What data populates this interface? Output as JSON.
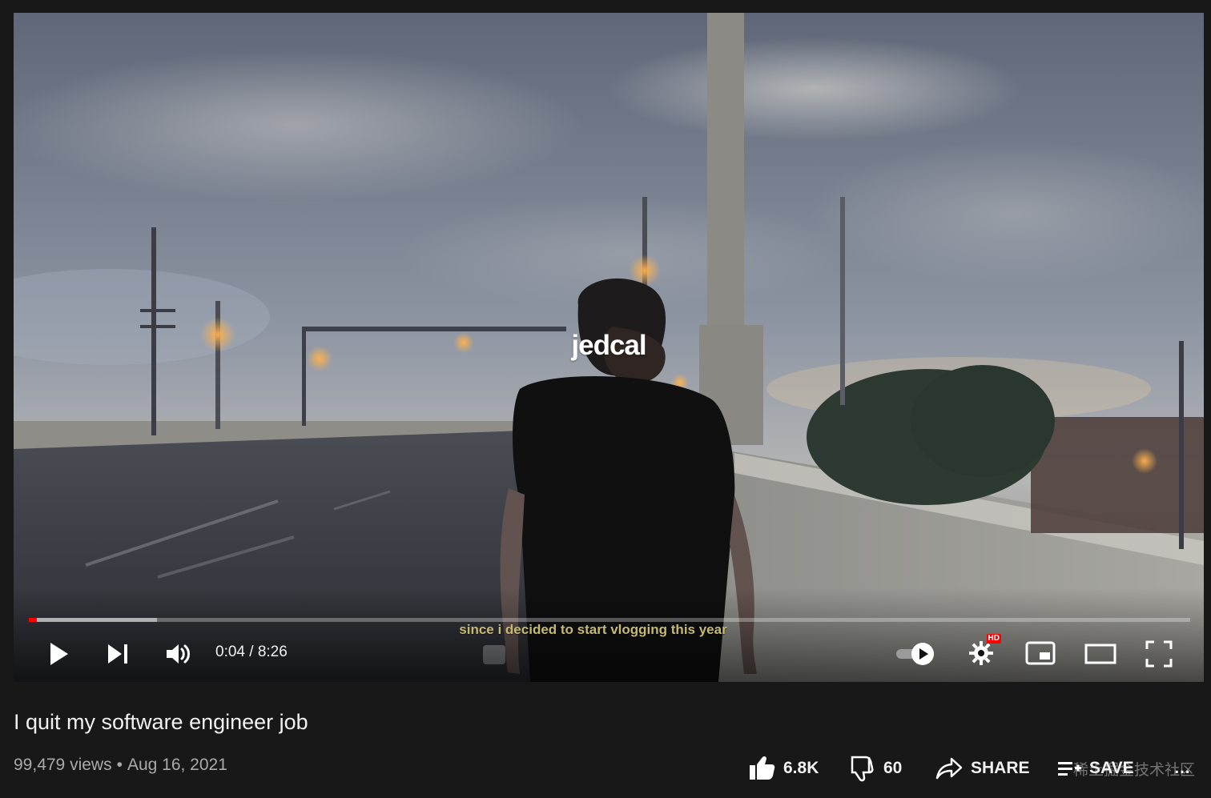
{
  "player": {
    "watermark": "jedcal",
    "caption": "since i decided to start vlogging this year",
    "time_current": "0:04",
    "time_separator": " / ",
    "time_total": "8:26",
    "progress_played_fraction": 0.007,
    "progress_buffered_fraction": 0.11,
    "hd_badge": "HD",
    "autoplay_toggle_state": "on",
    "icons": {
      "play": "play-icon",
      "next": "next-icon",
      "volume": "volume-icon",
      "autoplay": "autoplay-toggle-icon",
      "settings": "settings-gear-icon",
      "miniplayer": "miniplayer-icon",
      "theater": "theater-mode-icon",
      "fullscreen": "fullscreen-icon"
    }
  },
  "video": {
    "title": "I quit my software engineer job",
    "views": "99,479 views",
    "separator": "•",
    "date": "Aug 16, 2021"
  },
  "actions": {
    "like_count": "6.8K",
    "dislike_count": "60",
    "share_label": "SHARE",
    "save_label": "SAVE",
    "more_label": "…",
    "overlay_text": "稀土掘金技术社区"
  },
  "colors": {
    "background": "#181818",
    "progress_played": "#ff0000",
    "caption": "#c5ba70",
    "meta": "#aaaaaa",
    "text": "#f1f1f1"
  }
}
